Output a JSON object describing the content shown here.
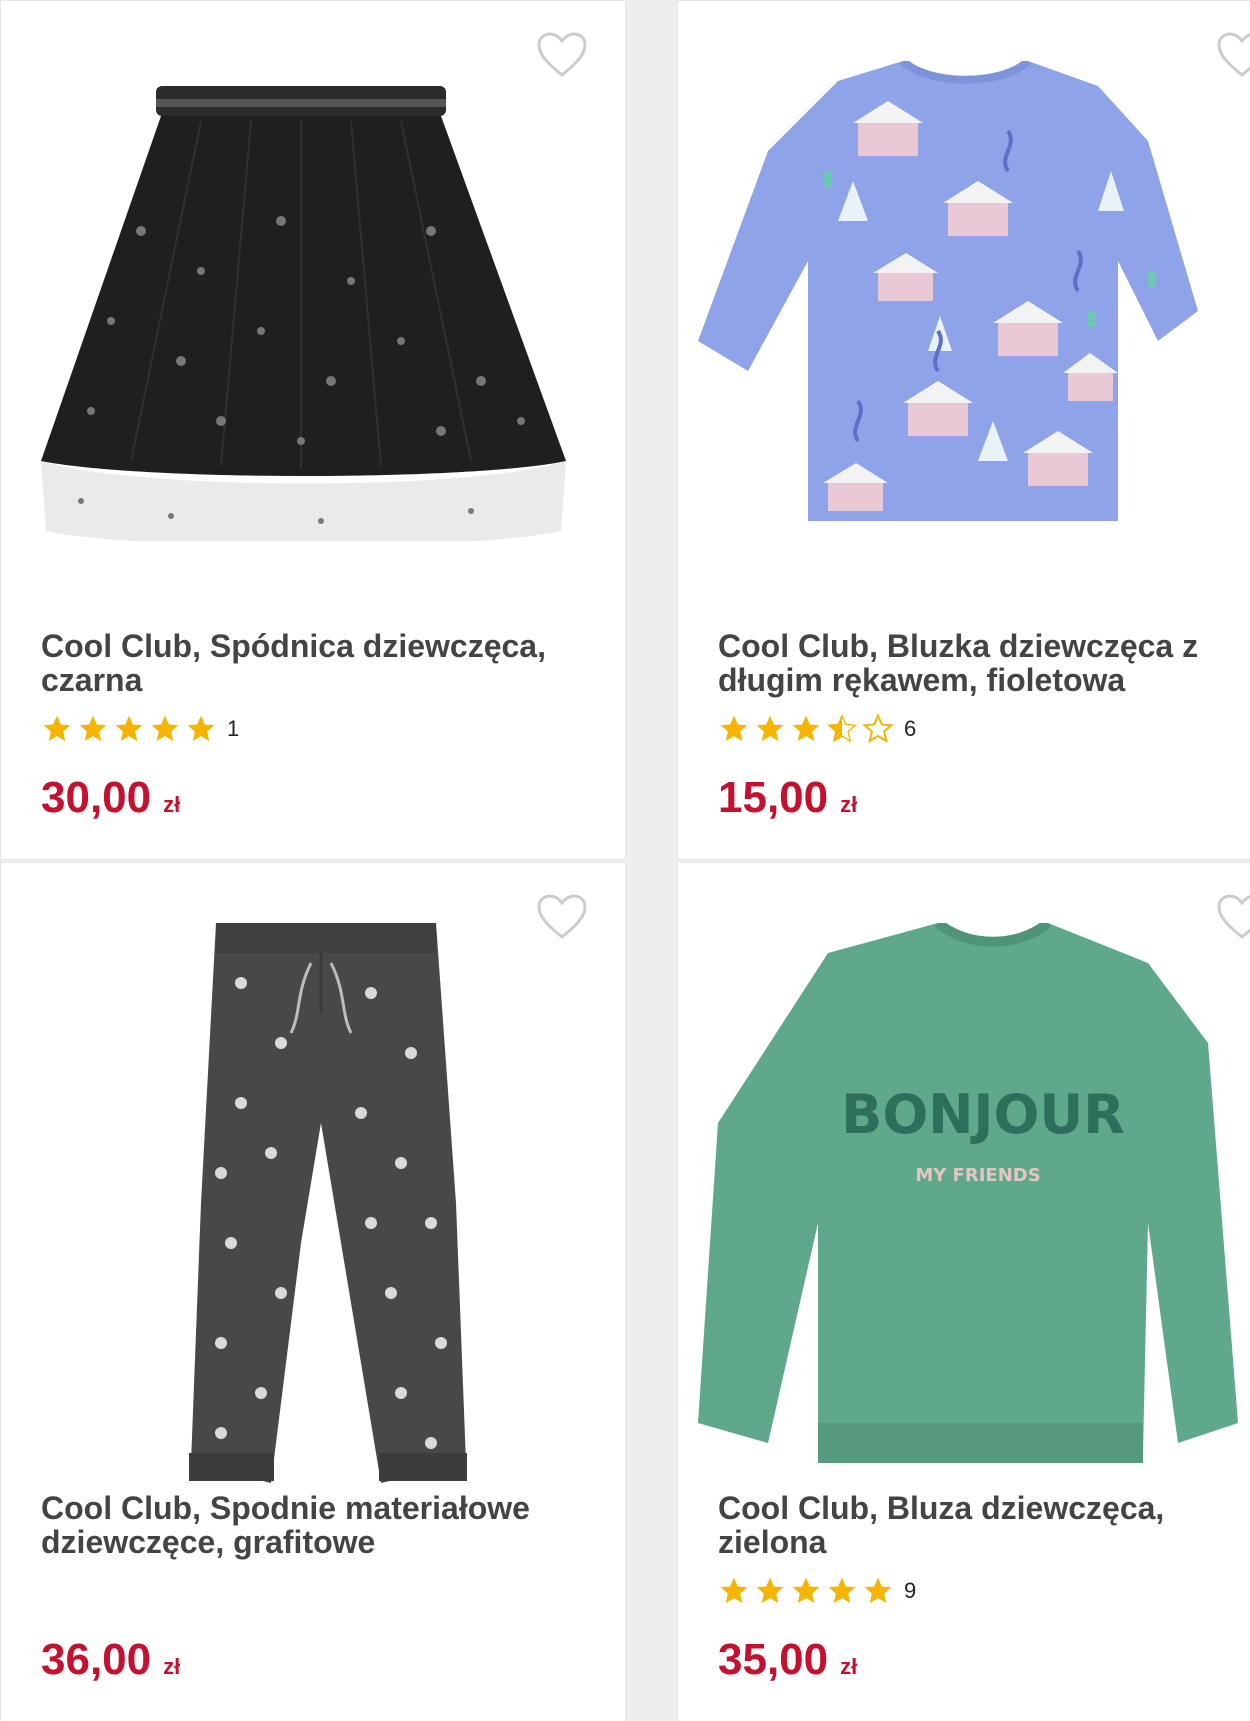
{
  "products": [
    {
      "title": "Cool Club, Spódnica dziewczęca, czarna",
      "rating": 5,
      "rating_count": "1",
      "price": "30,00",
      "currency": "zł",
      "image": "black tulle skirt with stars"
    },
    {
      "title": "Cool Club, Bluzka dziewczęca z długim rękawem, fioletowa",
      "rating": 3.5,
      "rating_count": "6",
      "price": "15,00",
      "currency": "zł",
      "image": "lilac long sleeve top with house print"
    },
    {
      "title": "Cool Club, Spodnie materiałowe dziewczęce, grafitowe",
      "rating": null,
      "rating_count": null,
      "price": "36,00",
      "currency": "zł",
      "image": "graphite polka dot trousers"
    },
    {
      "title": "Cool Club, Bluza dziewczęca, zielona",
      "rating": 5,
      "rating_count": "9",
      "price": "35,00",
      "currency": "zł",
      "image": "green sweatshirt",
      "image_text": {
        "main": "BONJOUR",
        "sub": "MY FRIENDS"
      }
    }
  ],
  "colors": {
    "price": "#c4112f",
    "star": "#f5b400",
    "title": "#444444"
  }
}
